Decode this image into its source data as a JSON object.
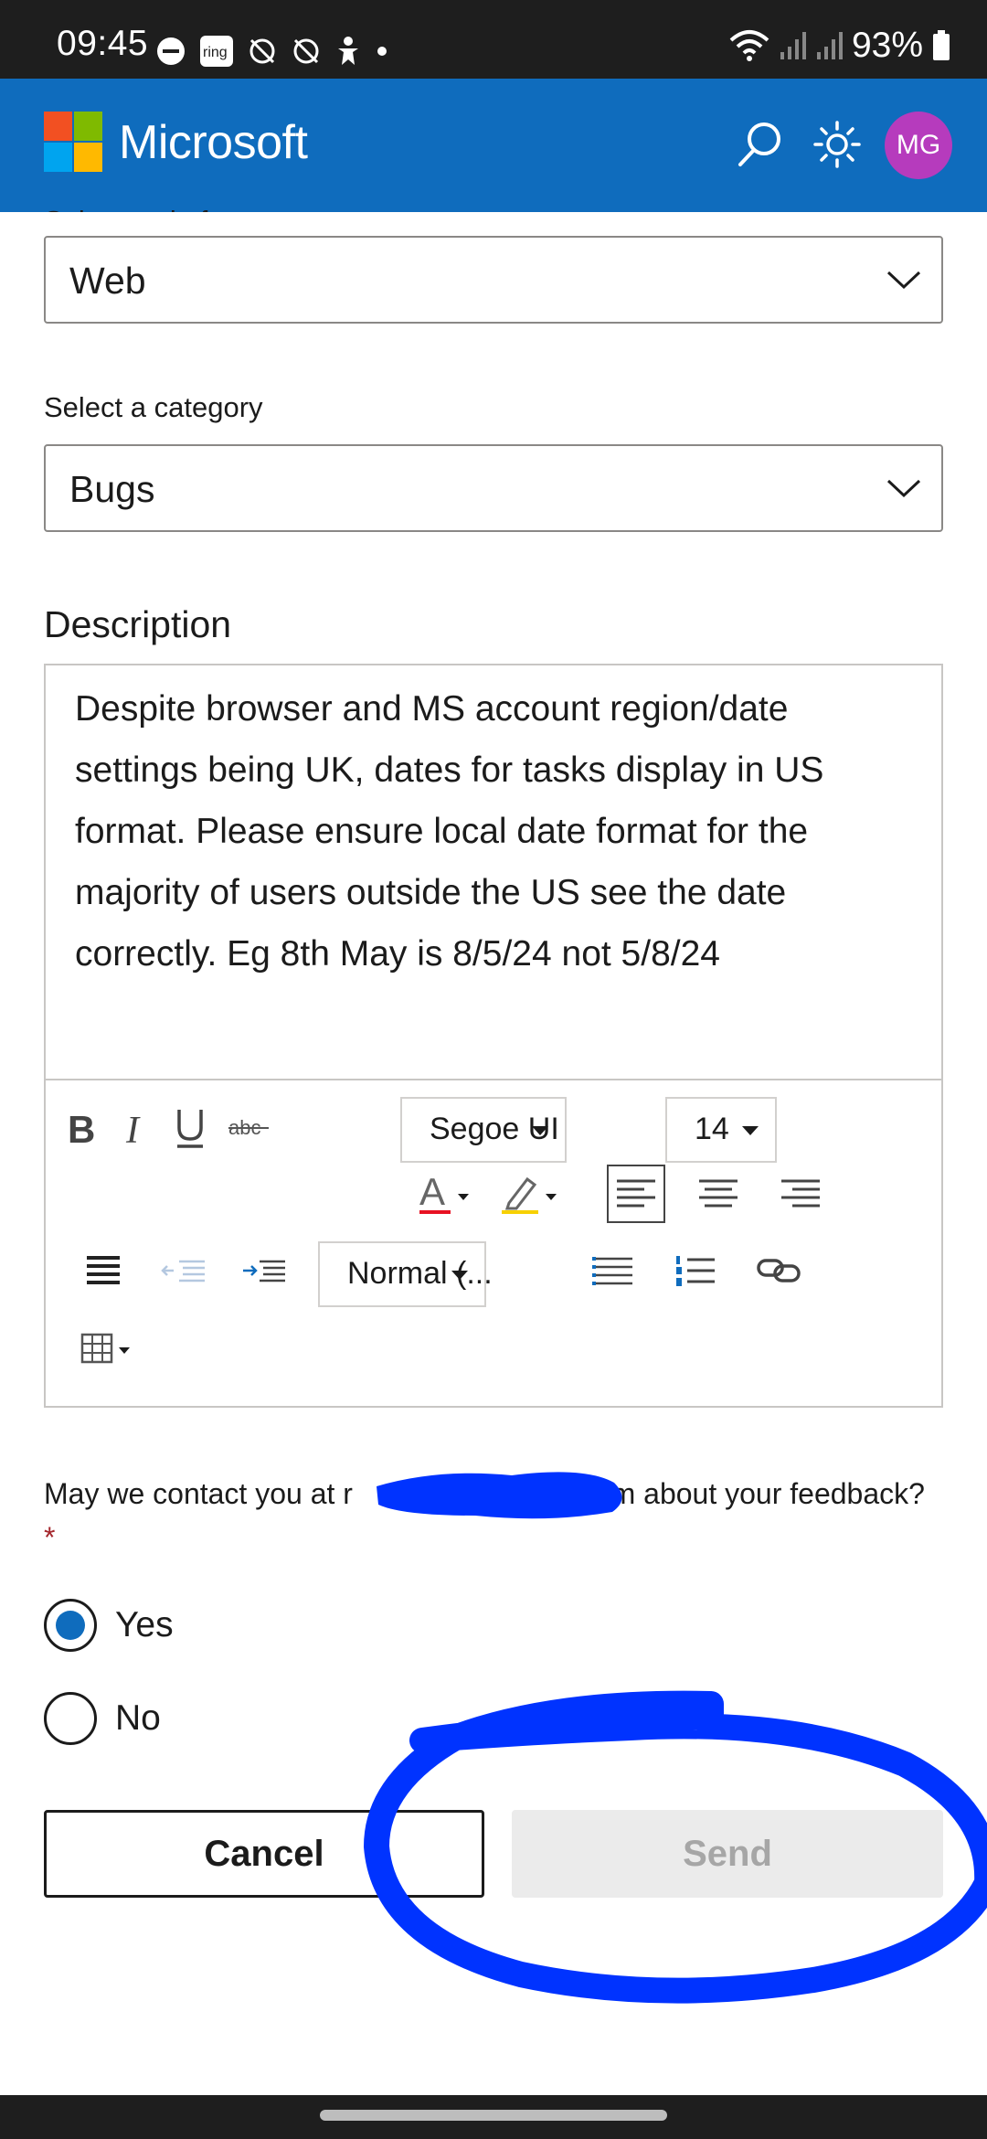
{
  "status_bar": {
    "time": "09:45",
    "battery": "93%",
    "ring_badge": "ring",
    "icons": [
      "dnd-icon",
      "ring-app-icon",
      "sync-off-icon",
      "sync-off-icon",
      "accessibility-icon",
      "dot-icon",
      "wifi-icon",
      "signal-icon",
      "signal-icon",
      "battery-icon"
    ]
  },
  "header": {
    "brand": "Microsoft",
    "avatar_initials": "MG",
    "colors": {
      "bar": "#0f6cbd",
      "avatar": "#b63bbd"
    }
  },
  "form": {
    "partial_label": "Select a platform",
    "platform_value": "Web",
    "category_label": "Select a category",
    "category_value": "Bugs",
    "description_title": "Description",
    "description_text": "Despite browser and MS account region/date settings being UK, dates for tasks display in US format. Please ensure local date format for the majority of users outside the US see the date correctly. Eg 8th May is 8/5/24 not 5/8/24",
    "toolbar": {
      "font_family": "Segoe UI",
      "font_size": "14",
      "paragraph_style": "Normal (..."
    },
    "contact_prefix": "May we contact you at r",
    "contact_suffix": ".com about your feedback?",
    "required_mark": "*",
    "radio_yes": "Yes",
    "radio_no": "No",
    "selected_option": "Yes",
    "cancel_label": "Cancel",
    "send_label": "Send"
  }
}
